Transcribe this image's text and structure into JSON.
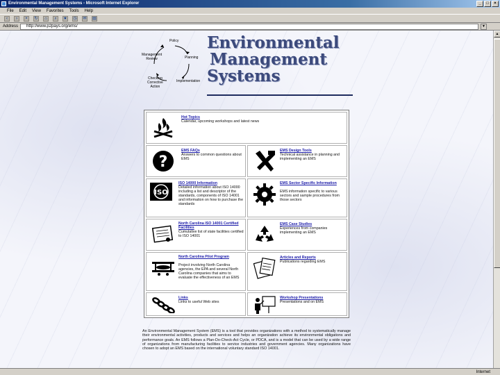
{
  "window": {
    "title": "Environmental Management Systems - Microsoft Internet Explorer",
    "buttons": [
      "_",
      "□",
      "×"
    ]
  },
  "menu": [
    "File",
    "Edit",
    "View",
    "Favorites",
    "Tools",
    "Help"
  ],
  "address": {
    "label": "Address",
    "url": "http://www.p2pays.org/ems/"
  },
  "status": {
    "left": "",
    "zone": "Internet"
  },
  "cycle": {
    "labels": {
      "policy": "Policy",
      "planning": "Planning",
      "implementation": "Implementation",
      "checking": "Checking\nCorrective\nAction",
      "review": "Management\nReview"
    }
  },
  "page": {
    "title_lines": [
      "Environmental",
      "Management",
      "Systems"
    ],
    "sections": {
      "hot_topics": {
        "title": "Hot Topics",
        "desc": "Calendar, upcoming workshops and latest news"
      },
      "faqs": {
        "title": "EMS FAQs",
        "desc": "Answers to common questions about EMS"
      },
      "design_tools": {
        "title": "EMS Design Tools",
        "desc": "Technical assistance in planning and implementing an EMS"
      },
      "iso": {
        "title": "ISO 14000 Information",
        "desc": "Detailed information about ISO 14000 including a list and descriptor of the standards, components of ISO 14001 and information on how to purchase the standards"
      },
      "sector": {
        "title": "EMS Sector Specific Information",
        "desc": "EMS information specific to various sectors and sample procedures from those sectors"
      },
      "nc_certified": {
        "title": "North Carolina ISO 14001 Certified Facilities",
        "desc": "Cumulative list of state facilities certified to ISO 14001"
      },
      "case_studies": {
        "title": "EMS Case Studies",
        "desc": "Experiences from companies implementing an EMS"
      },
      "nc_pilot": {
        "title": "North Carolina Pilot Program",
        "desc": "Project involving North Carolina agencies, the EPA and several North Carolina companies that aims to evaluate the effectiveness of an EMS"
      },
      "articles": {
        "title": "Articles and Reports",
        "desc": "Publications regarding EMS"
      },
      "links": {
        "title": "Links",
        "desc": "Links to useful Web sites"
      },
      "workshop": {
        "title": "Workshop Presentations",
        "desc": "Presentations and on EMS"
      }
    },
    "intro": "An Environmental Management System (EMS) is a tool that provides organizations with a method to systematically manage their environmental activities, products and services and helps an organization achieve its environmental obligations and performance goals. An EMS follows a Plan-Do-Check-Act Cycle, or PDCA, and is a model that can be used by a wide range of organizations from manufacturing facilities to service industries and government agencies. Many organizations have chosen to adopt an EMS based on the international voluntary standard ISO 14001."
  }
}
